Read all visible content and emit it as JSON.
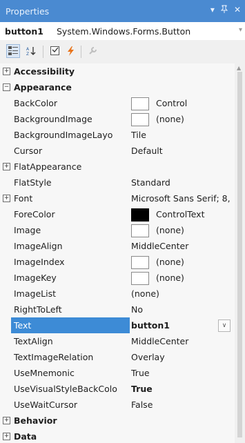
{
  "window": {
    "title": "Properties",
    "pin_glyph": "▾",
    "autohide_glyph": "ᛘ",
    "close_glyph": "✕"
  },
  "object_selector": {
    "name": "button1",
    "type": "System.Windows.Forms.Button"
  },
  "toolbar": {
    "buttons": [
      {
        "name": "categorized-icon",
        "active": true
      },
      {
        "name": "alphabetical-icon",
        "active": false
      },
      {
        "name": "properties-icon",
        "active": false
      },
      {
        "name": "events-icon",
        "active": false
      },
      {
        "name": "property-pages-icon",
        "active": false
      }
    ]
  },
  "rows": [
    {
      "type": "category",
      "name": "Accessibility",
      "expander": "⊞"
    },
    {
      "type": "category",
      "name": "Appearance",
      "expander": "⊟"
    },
    {
      "type": "prop",
      "name": "BackColor",
      "value": "Control",
      "swatch": "white"
    },
    {
      "type": "prop",
      "name": "BackgroundImage",
      "value": "(none)",
      "swatch": "white"
    },
    {
      "type": "prop",
      "name": "BackgroundImageLayo",
      "value": "Tile"
    },
    {
      "type": "prop",
      "name": "Cursor",
      "value": "Default"
    },
    {
      "type": "prop",
      "name": "FlatAppearance",
      "value": "",
      "expander": "⊞"
    },
    {
      "type": "prop",
      "name": "FlatStyle",
      "value": "Standard"
    },
    {
      "type": "prop",
      "name": "Font",
      "value": "Microsoft Sans Serif; 8,",
      "expander": "⊞"
    },
    {
      "type": "prop",
      "name": "ForeColor",
      "value": "ControlText",
      "swatch": "black"
    },
    {
      "type": "prop",
      "name": "Image",
      "value": "(none)",
      "swatch": "white"
    },
    {
      "type": "prop",
      "name": "ImageAlign",
      "value": "MiddleCenter"
    },
    {
      "type": "prop",
      "name": "ImageIndex",
      "value": "(none)",
      "swatch": "white"
    },
    {
      "type": "prop",
      "name": "ImageKey",
      "value": "(none)",
      "swatch": "white"
    },
    {
      "type": "prop",
      "name": "ImageList",
      "value": "(none)"
    },
    {
      "type": "prop",
      "name": "RightToLeft",
      "value": "No"
    },
    {
      "type": "prop",
      "name": "Text",
      "value": "button1",
      "selected": true,
      "bold": true,
      "dropdown": true
    },
    {
      "type": "prop",
      "name": "TextAlign",
      "value": "MiddleCenter"
    },
    {
      "type": "prop",
      "name": "TextImageRelation",
      "value": "Overlay"
    },
    {
      "type": "prop",
      "name": "UseMnemonic",
      "value": "True"
    },
    {
      "type": "prop",
      "name": "UseVisualStyleBackColo",
      "value": "True",
      "bold": true
    },
    {
      "type": "prop",
      "name": "UseWaitCursor",
      "value": "False"
    },
    {
      "type": "category",
      "name": "Behavior",
      "expander": "⊞"
    },
    {
      "type": "category",
      "name": "Data",
      "expander": "⊞"
    }
  ],
  "colors": {
    "titlebar": "#4a8ad1",
    "selection": "#3d8bd6",
    "events_icon": "#e8731a"
  }
}
